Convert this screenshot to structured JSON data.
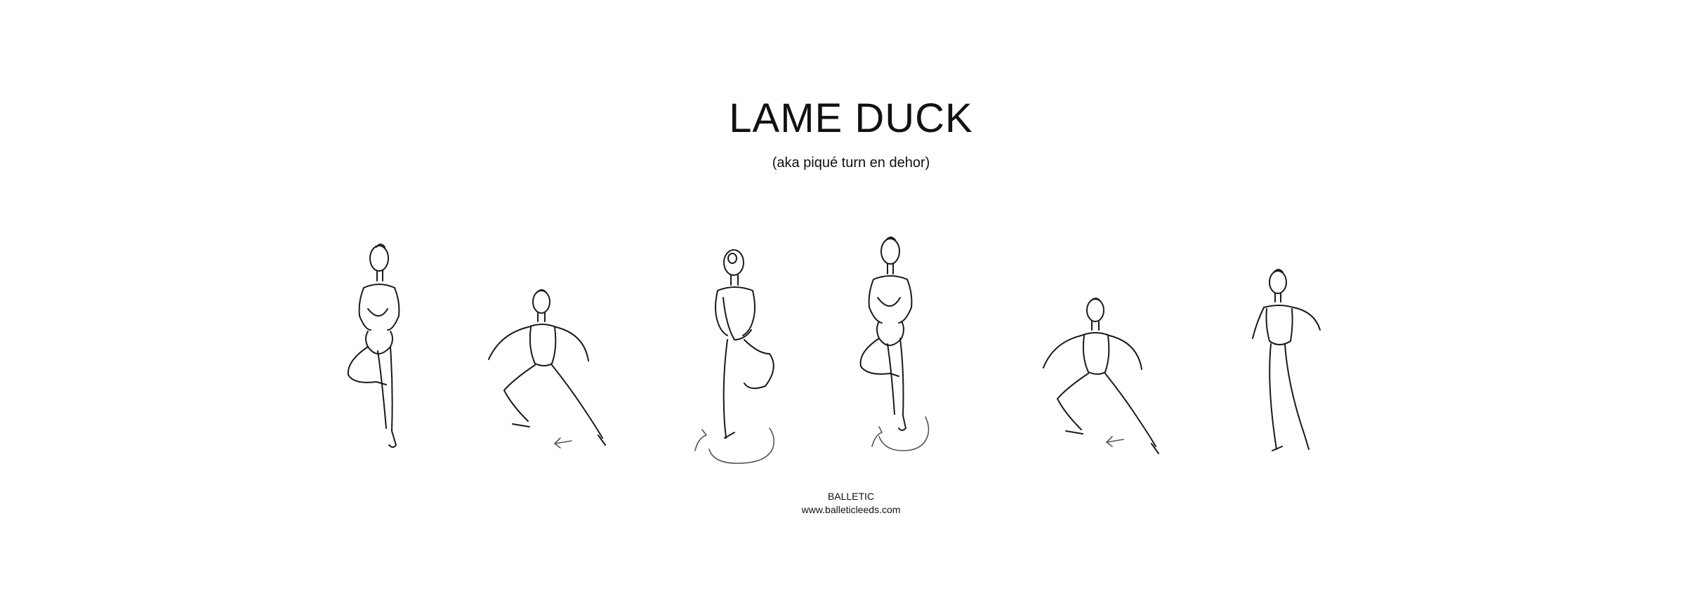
{
  "title": "LAME DUCK",
  "subtitle": "(aka piqué turn en dehor)",
  "figures": [
    {
      "pose": "retire-front"
    },
    {
      "pose": "plie-second-arms-open"
    },
    {
      "pose": "retire-back-turning"
    },
    {
      "pose": "retire-front-turning"
    },
    {
      "pose": "plie-second-arms-open"
    },
    {
      "pose": "finish-arms-open"
    }
  ],
  "footer": {
    "brand": "BALLETIC",
    "url": "www.balleticleeds.com"
  },
  "colors": {
    "ink": "#1a1a1a",
    "arrow": "#555555",
    "background": "#ffffff"
  }
}
